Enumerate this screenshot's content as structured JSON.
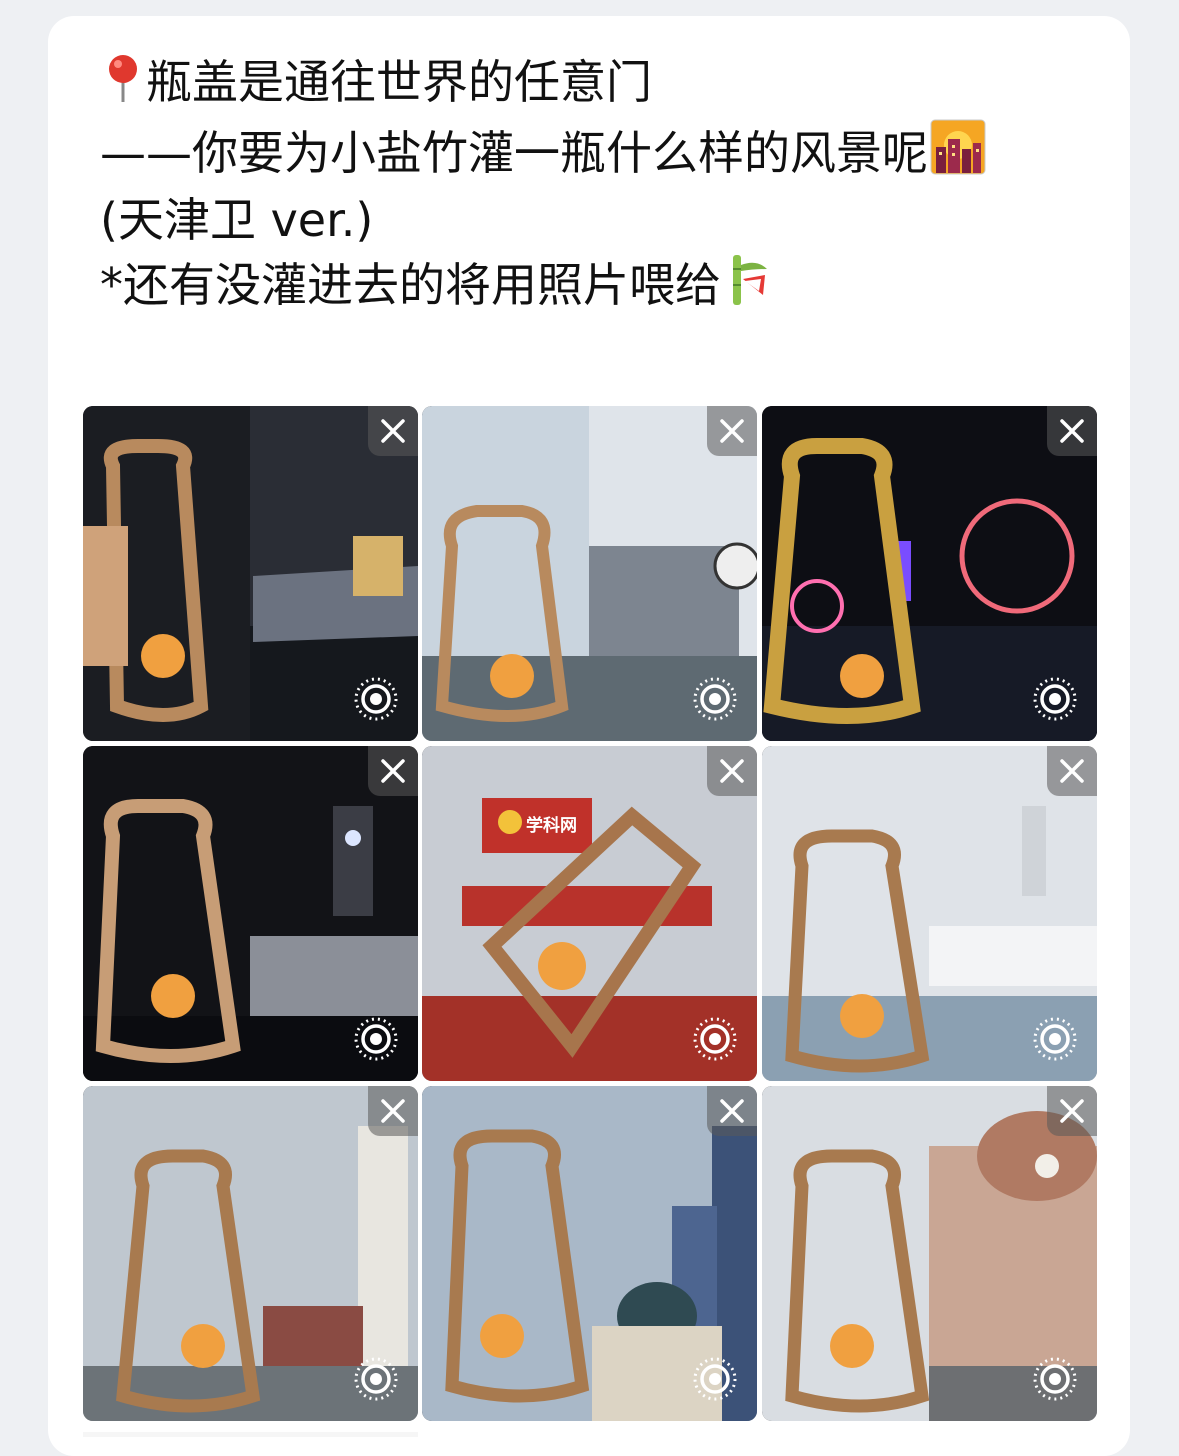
{
  "post": {
    "line1": "瓶盖是通往世界的任意门",
    "line2": "——你要为小盐竹灌一瓶什么样的风景呢",
    "line3": "(天津卫 ver.)",
    "line4": "*还有没灌进去的将用照片喂给",
    "emoji_icons": [
      "pin-icon",
      "night-city-icon",
      "bamboo-icon"
    ]
  },
  "photos": {
    "count": 9,
    "items": [
      {
        "theme": "night-bridge"
      },
      {
        "theme": "day-bridge"
      },
      {
        "theme": "ferris-wheel-night"
      },
      {
        "theme": "night-clock-tower"
      },
      {
        "theme": "expo-hall",
        "sign": "学科网"
      },
      {
        "theme": "day-station"
      },
      {
        "theme": "day-tower"
      },
      {
        "theme": "skyscraper-dome"
      },
      {
        "theme": "station-dusk"
      }
    ],
    "close_icon": "close-icon",
    "live_icon": "live-photo-icon"
  },
  "colors": {
    "text": "#111111",
    "card": "#ffffff",
    "page": "#eef0f3",
    "bottle": "#b88a5e"
  }
}
